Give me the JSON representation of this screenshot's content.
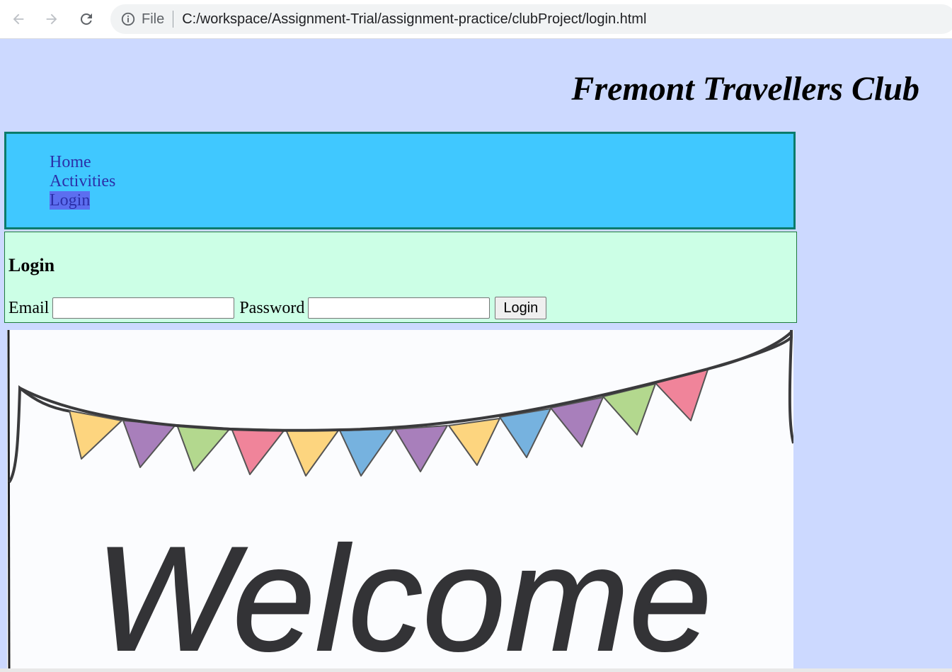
{
  "browser": {
    "scheme_label": "File",
    "url": "C:/workspace/Assignment-Trial/assignment-practice/clubProject/login.html"
  },
  "header": {
    "title": "Fremont Travellers Club"
  },
  "nav": {
    "items": [
      {
        "label": "Home"
      },
      {
        "label": "Activities"
      },
      {
        "label": "Login",
        "active": true
      }
    ]
  },
  "login": {
    "heading": "Login",
    "email_label": "Email",
    "email_value": "",
    "password_label": "Password",
    "password_value": "",
    "submit_label": "Login"
  },
  "banner": {
    "text": "Welcome",
    "flag_colors": [
      "#fdd57f",
      "#a87fbb",
      "#b3d88e",
      "#f0849a",
      "#76b2df"
    ]
  },
  "colors": {
    "page_bg": "#ccd9ff",
    "menu_bg": "#40c8ff",
    "menu_border": "#0b7b6b",
    "login_bg": "#ccffe6",
    "link": "#2b2fa8",
    "active_link_bg": "#5c6ef0"
  }
}
